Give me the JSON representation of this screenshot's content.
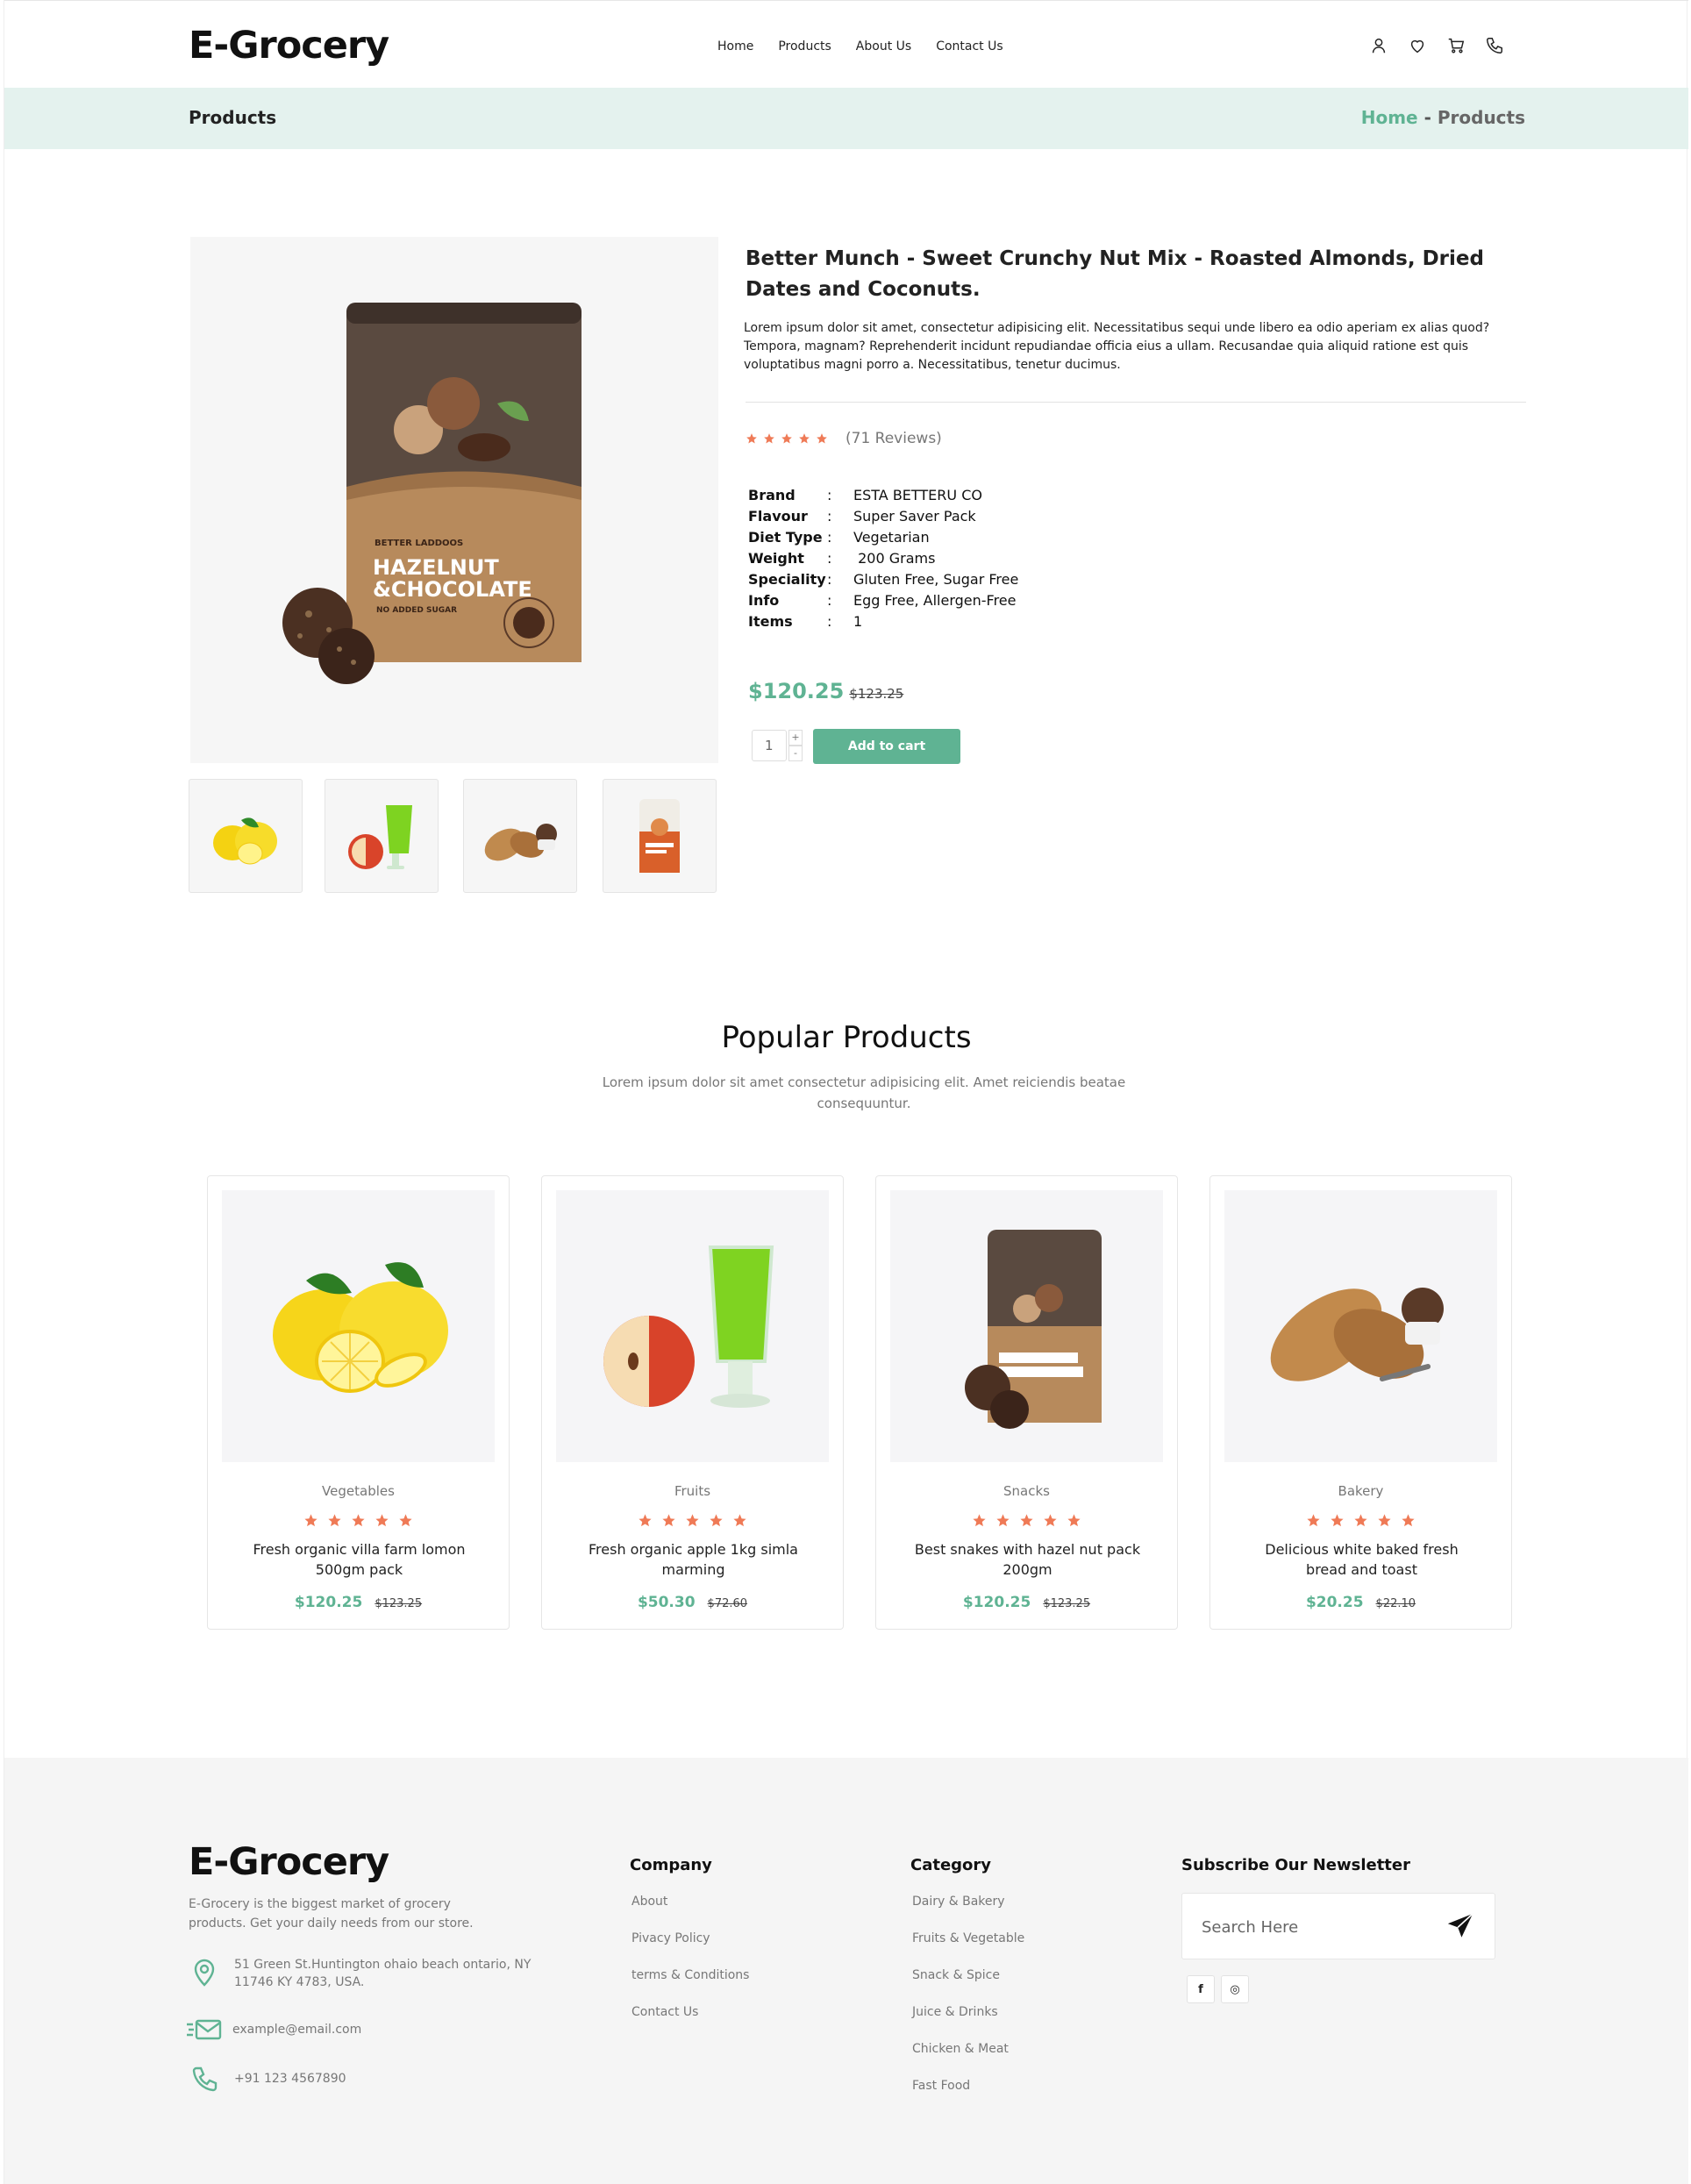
{
  "brand": "E-Grocery",
  "nav": [
    "Home",
    "Products",
    "About Us",
    "Contact Us"
  ],
  "header_icons": [
    "user-icon",
    "heart-icon",
    "cart-icon",
    "phone-icon"
  ],
  "banner": {
    "title": "Products",
    "breadcrumb_home": "Home",
    "breadcrumb_sep": "-",
    "breadcrumb_current": "Products"
  },
  "product": {
    "title": "Better Munch - Sweet Crunchy Nut Mix - Roasted Almonds, Dried Dates and Coconuts.",
    "description": "Lorem ipsum dolor sit amet, consectetur adipisicing elit. Necessitatibus sequi unde libero ea odio aperiam ex alias quod? Tempora, magnam? Reprehenderit incidunt repudiandae officia eius a ullam. Recusandae quia aliquid ratione est quis voluptatibus magni porro a. Necessitatibus, tenetur ducimus.",
    "rating": 5,
    "reviews": "(71 Reviews)",
    "specs": [
      {
        "key": "Brand",
        "value": "ESTA BETTERU CO"
      },
      {
        "key": "Flavour",
        "value": "Super Saver Pack"
      },
      {
        "key": "Diet Type",
        "value": "Vegetarian"
      },
      {
        "key": "Weight",
        "value": " 200 Grams"
      },
      {
        "key": "Speciality",
        "value": "Gluten Free, Sugar Free"
      },
      {
        "key": "Info",
        "value": "Egg Free, Allergen-Free"
      },
      {
        "key": "Items",
        "value": "1"
      }
    ],
    "spec_separator": ":",
    "price": "$120.25",
    "old_price": "$123.25",
    "quantity": "1",
    "qty_plus": "+",
    "qty_minus": "-",
    "add_to_cart": "Add to cart",
    "pack_line1": "BETTER LADDOOS",
    "pack_line2": "HAZELNUT",
    "pack_line3": "&CHOCOLATE",
    "pack_line4": "NO ADDED SUGAR",
    "thumbnails": [
      "lemon",
      "apple-juice",
      "bread",
      "snack-pack"
    ]
  },
  "popular": {
    "title": "Popular Products",
    "subtitle": "Lorem ipsum dolor sit amet consectetur adipisicing elit. Amet reiciendis beatae consequuntur.",
    "items": [
      {
        "category": "Vegetables",
        "name": "Fresh organic villa farm lomon 500gm pack",
        "price": "$120.25",
        "old_price": "$123.25",
        "image": "lemon"
      },
      {
        "category": "Fruits",
        "name": "Fresh organic apple 1kg simla marming",
        "price": "$50.30",
        "old_price": "$72.60",
        "image": "apple-juice"
      },
      {
        "category": "Snacks",
        "name": "Best snakes with hazel nut pack 200gm",
        "price": "$120.25",
        "old_price": "$123.25",
        "image": "snack-pack"
      },
      {
        "category": "Bakery",
        "name": "Delicious white baked fresh bread and toast",
        "price": "$20.25",
        "old_price": "$22.10",
        "image": "bread"
      }
    ]
  },
  "footer": {
    "brand": "E-Grocery",
    "about": "E-Grocery is the biggest market of grocery products. Get your daily needs from our store.",
    "address": "51 Green St.Huntington ohaio beach ontario, NY 11746 KY 4783, USA.",
    "email": "example@email.com",
    "phone": "+91 123 4567890",
    "company_title": "Company",
    "company_links": [
      "About",
      "Pivacy Policy",
      "terms & Conditions",
      "Contact Us"
    ],
    "category_title": "Category",
    "category_links": [
      "Dairy & Bakery",
      "Fruits & Vegetable",
      "Snack & Spice",
      "Juice & Drinks",
      "Chicken & Meat",
      "Fast Food"
    ],
    "newsletter_title": "Subscribe Our Newsletter",
    "newsletter_placeholder": "Search Here",
    "social": [
      "facebook-icon",
      "instagram-icon"
    ],
    "social_glyphs": [
      "f",
      "◎"
    ]
  },
  "colors": {
    "accent": "#5fb393",
    "banner_bg": "#e4f2ee",
    "star": "#ef7a56",
    "footer_bg": "#f5f5f5"
  }
}
